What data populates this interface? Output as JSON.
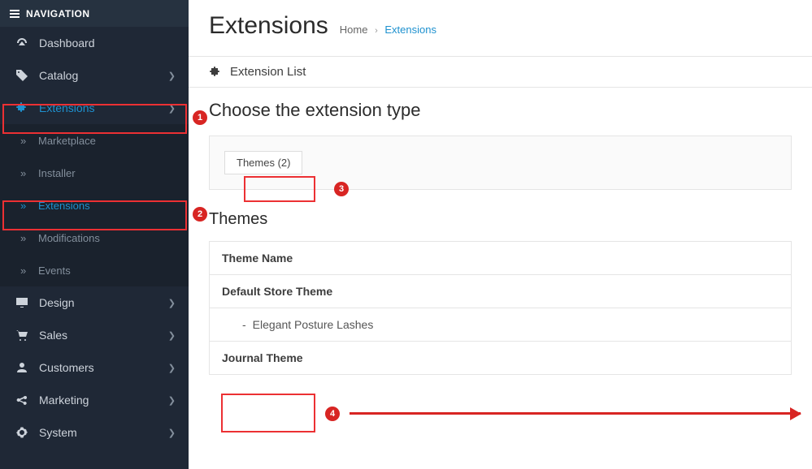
{
  "sidebar": {
    "header": "NAVIGATION",
    "items": [
      {
        "label": "Dashboard",
        "icon": "dashboard-icon",
        "expandable": false
      },
      {
        "label": "Catalog",
        "icon": "tag-icon",
        "expandable": true
      },
      {
        "label": "Extensions",
        "icon": "puzzle-icon",
        "expandable": true,
        "active": true,
        "children": [
          {
            "label": "Marketplace"
          },
          {
            "label": "Installer"
          },
          {
            "label": "Extensions",
            "active": true
          },
          {
            "label": "Modifications"
          },
          {
            "label": "Events"
          }
        ]
      },
      {
        "label": "Design",
        "icon": "monitor-icon",
        "expandable": true
      },
      {
        "label": "Sales",
        "icon": "cart-icon",
        "expandable": true
      },
      {
        "label": "Customers",
        "icon": "user-icon",
        "expandable": true
      },
      {
        "label": "Marketing",
        "icon": "share-icon",
        "expandable": true
      },
      {
        "label": "System",
        "icon": "gear-icon",
        "expandable": true
      }
    ]
  },
  "header": {
    "title": "Extensions",
    "breadcrumb": {
      "home": "Home",
      "current": "Extensions"
    }
  },
  "panel": {
    "heading": "Extension List",
    "choose_label": "Choose the extension type",
    "type_selected": "Themes (2)",
    "themes_heading": "Themes",
    "table": {
      "col_name": "Theme Name",
      "rows": [
        {
          "title": "Default Store Theme",
          "type": "header"
        },
        {
          "title": "Elegant Posture Lashes",
          "type": "store"
        },
        {
          "title": "Journal Theme",
          "type": "header"
        }
      ]
    }
  },
  "annotations": {
    "n1": "1",
    "n2": "2",
    "n3": "3",
    "n4": "4"
  }
}
